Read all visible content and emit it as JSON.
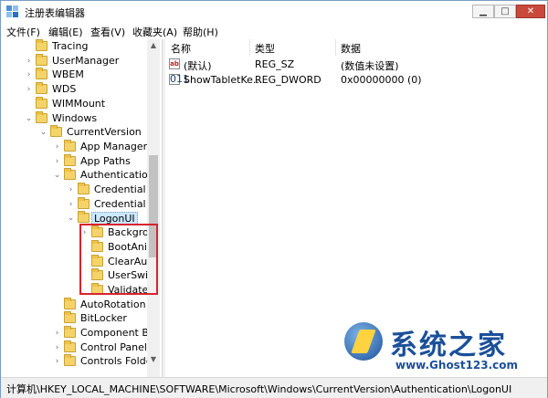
{
  "window": {
    "title": "注册表编辑器"
  },
  "menu": [
    "文件(F)",
    "编辑(E)",
    "查看(V)",
    "收藏夹(A)",
    "帮助(H)"
  ],
  "tree": [
    {
      "label": "Tracing",
      "level": 2,
      "expander": ""
    },
    {
      "label": "UserManager",
      "level": 2,
      "expander": ">"
    },
    {
      "label": "WBEM",
      "level": 2,
      "expander": ">"
    },
    {
      "label": "WDS",
      "level": 2,
      "expander": ">"
    },
    {
      "label": "WIMMount",
      "level": 2,
      "expander": ""
    },
    {
      "label": "Windows",
      "level": 2,
      "expander": "v"
    },
    {
      "label": "CurrentVersion",
      "level": 3,
      "expander": "v"
    },
    {
      "label": "App Manageme",
      "level": 4,
      "expander": ">"
    },
    {
      "label": "App Paths",
      "level": 4,
      "expander": ">"
    },
    {
      "label": "Authentication",
      "level": 4,
      "expander": "v"
    },
    {
      "label": "Credential Pr",
      "level": 5,
      "expander": ">"
    },
    {
      "label": "Credential Pr",
      "level": 5,
      "expander": ">"
    },
    {
      "label": "LogonUI",
      "level": 5,
      "expander": "v",
      "selected": true
    },
    {
      "label": "Backgrou",
      "level": 6,
      "expander": ">"
    },
    {
      "label": "BootAnim",
      "level": 6,
      "expander": ""
    },
    {
      "label": "ClearAuto",
      "level": 6,
      "expander": ""
    },
    {
      "label": "UserSwitc",
      "level": 6,
      "expander": ""
    },
    {
      "label": "ValidateU",
      "level": 6,
      "expander": ""
    },
    {
      "label": "AutoRotation",
      "level": 4,
      "expander": ""
    },
    {
      "label": "BitLocker",
      "level": 4,
      "expander": ""
    },
    {
      "label": "Component Base",
      "level": 4,
      "expander": ">"
    },
    {
      "label": "Control Panel",
      "level": 4,
      "expander": ">"
    },
    {
      "label": "Controls Folder",
      "level": 4,
      "expander": ">"
    }
  ],
  "columns": {
    "name": "名称",
    "type": "类型",
    "data": "数据"
  },
  "values": [
    {
      "icon": "ab",
      "name": "(默认)",
      "type": "REG_SZ",
      "data": "(数值未设置)"
    },
    {
      "icon": "011",
      "name": "ShowTabletKe...",
      "type": "REG_DWORD",
      "data": "0x00000000 (0)"
    }
  ],
  "status": "计算机\\HKEY_LOCAL_MACHINE\\SOFTWARE\\Microsoft\\Windows\\CurrentVersion\\Authentication\\LogonUI",
  "watermark": {
    "name": "系统之家",
    "url": "www.Ghost123.com"
  }
}
